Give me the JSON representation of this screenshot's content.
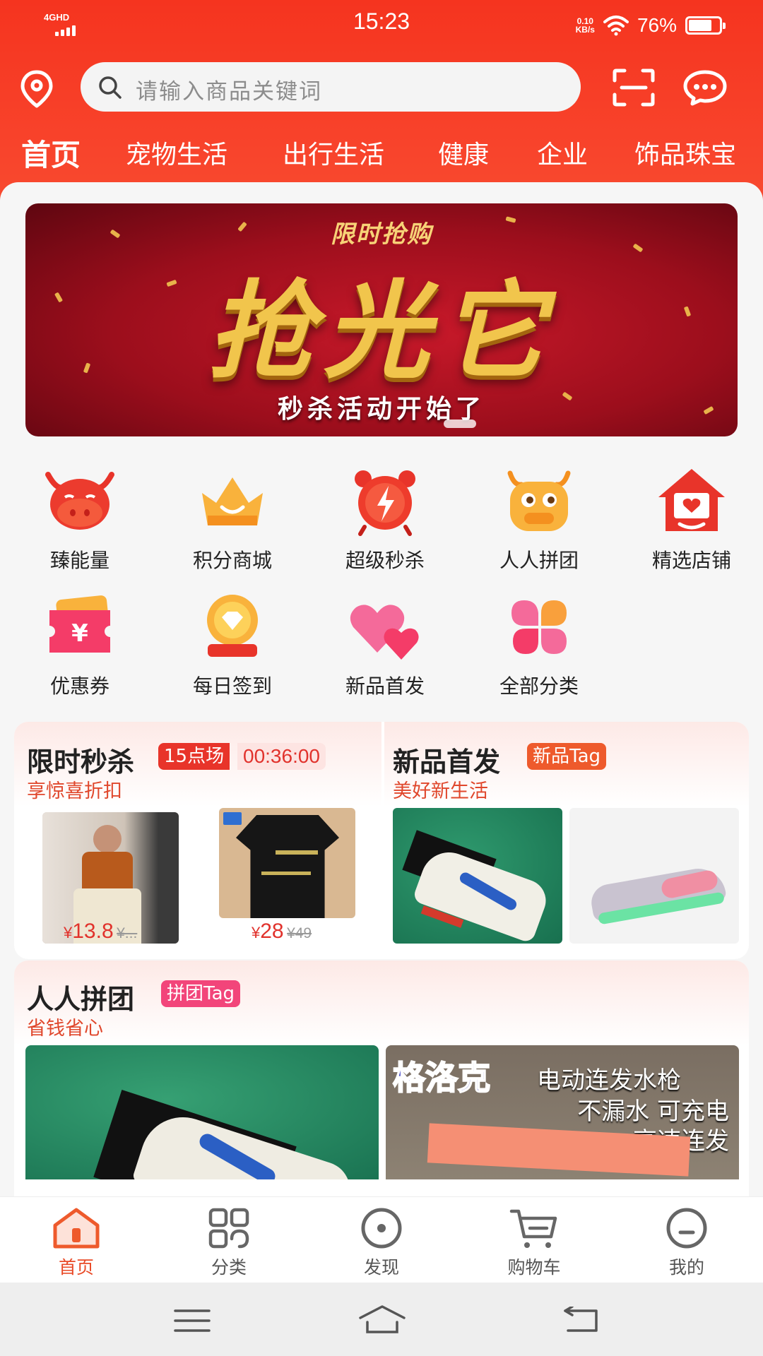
{
  "status_bar": {
    "network": "4GHD",
    "time": "15:23",
    "speed_value": "0.10",
    "speed_unit": "KB/s",
    "battery": "76%",
    "battery_level": 0.76
  },
  "header": {
    "search_placeholder": "请输入商品关键词",
    "tabs": [
      "首页",
      "宠物生活",
      "出行生活",
      "健康",
      "企业",
      "饰品珠宝"
    ],
    "active_tab": 0
  },
  "banner": {
    "top_text": "限时抢购",
    "headline": "抢光它",
    "subtitle": "秒杀活动开始了"
  },
  "quick_grid": [
    {
      "label": "臻能量",
      "icon": "cow-face-icon"
    },
    {
      "label": "积分商城",
      "icon": "crown-icon"
    },
    {
      "label": "超级秒杀",
      "icon": "alarm-clock-icon"
    },
    {
      "label": "人人拼团",
      "icon": "cow-group-icon"
    },
    {
      "label": "精选店铺",
      "icon": "shop-house-icon"
    },
    {
      "label": "优惠券",
      "icon": "coupon-icon"
    },
    {
      "label": "每日签到",
      "icon": "sign-in-medal-icon"
    },
    {
      "label": "新品首发",
      "icon": "hearts-icon"
    },
    {
      "label": "全部分类",
      "icon": "clover-icon"
    }
  ],
  "flash_sale": {
    "title": "限时秒杀",
    "session": "15点场",
    "countdown": "00:36:00",
    "subtitle": "享惊喜折扣",
    "products": [
      {
        "price_symbol": "¥",
        "price": "13.8",
        "old_price": "¥..."
      },
      {
        "price_symbol": "¥",
        "price": "28",
        "old_price": "¥49"
      }
    ]
  },
  "new_arrivals": {
    "title": "新品首发",
    "tag": "新品Tag",
    "subtitle": "美好新生活"
  },
  "group_buy": {
    "title": "人人拼团",
    "tag": "拼团Tag",
    "subtitle": "省钱省心",
    "promo_brand": "格洛克",
    "promo_line1": "电动连发水枪",
    "promo_line2": "不漏水 可充电",
    "promo_line3": "高速连发"
  },
  "bottom_nav": [
    {
      "label": "首页",
      "icon": "home-icon"
    },
    {
      "label": "分类",
      "icon": "category-icon"
    },
    {
      "label": "发现",
      "icon": "discover-icon"
    },
    {
      "label": "购物车",
      "icon": "cart-icon"
    },
    {
      "label": "我的",
      "icon": "profile-icon"
    }
  ],
  "colors": {
    "brand_red": "#f5341f",
    "price_red": "#e1322c",
    "active_nav": "#e94a27",
    "subtitle_orange": "#e0472c"
  }
}
